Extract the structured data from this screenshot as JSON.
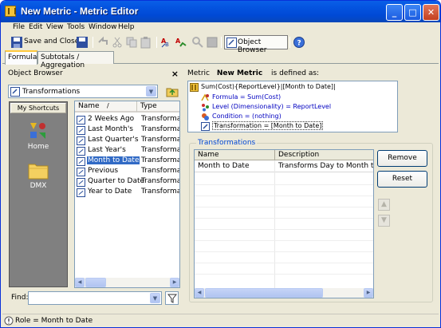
{
  "window": {
    "title": "New Metric - Metric Editor",
    "controls": {
      "minimize": "_",
      "maximize": "□",
      "close": "✕"
    }
  },
  "menu": [
    "File",
    "Edit",
    "View",
    "Tools",
    "Window",
    "Help"
  ],
  "toolbar": {
    "save_close_label": "Save and Close",
    "object_browser_label": "Object Browser"
  },
  "tabs": [
    "Formula",
    "Subtotals / Aggregation"
  ],
  "object_browser": {
    "header": "Object Browser",
    "folder_selected": "Transformations",
    "shortcuts_header": "My Shortcuts",
    "shortcut_items": [
      "Home",
      "DMX"
    ],
    "columns": [
      "Name",
      "Type"
    ],
    "sort_indicator": "/",
    "items": [
      {
        "name": "2 Weeks Ago",
        "type": "Transformation"
      },
      {
        "name": "Last Month's",
        "type": "Transformation"
      },
      {
        "name": "Last Quarter's",
        "type": "Transformation"
      },
      {
        "name": "Last Year's",
        "type": "Transformation"
      },
      {
        "name": "Month to Date",
        "type": "Transformation",
        "selected": true
      },
      {
        "name": "Previous",
        "type": "Transformation"
      },
      {
        "name": "Quarter to Date",
        "type": "Transformation"
      },
      {
        "name": "Year to Date",
        "type": "Transformation"
      }
    ],
    "find_label": "Find:",
    "find_value": ""
  },
  "metric": {
    "prefix": "Metric",
    "name": "New Metric",
    "suffix": "is defined as:",
    "definition": "Sum(Cost){ReportLevel}|[Month to Date]|",
    "formula": "Formula = Sum(Cost)",
    "level": "Level (Dimensionality) = ReportLevel",
    "condition": "Condition = (nothing)",
    "transformation": "Transformation = [Month to Date]"
  },
  "transformations": {
    "group_label": "Transformations",
    "columns": [
      "Name",
      "Description"
    ],
    "rows": [
      {
        "name": "Month to Date",
        "description": "Transforms Day to Month to Date"
      }
    ],
    "remove_label": "Remove",
    "reset_label": "Reset"
  },
  "status": {
    "text": "Role = Month to Date"
  },
  "colors": {
    "selection": "#316ac5",
    "title_bar": "#0054e3",
    "link_blue": "#0046d5"
  }
}
